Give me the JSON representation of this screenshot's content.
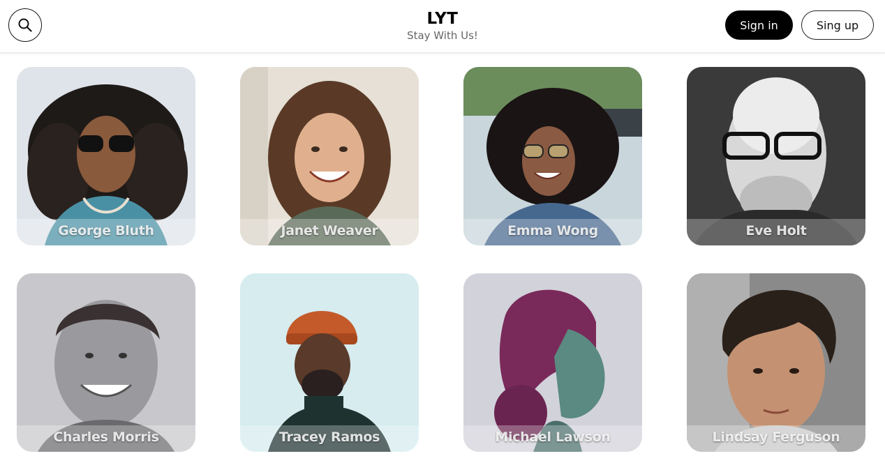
{
  "header": {
    "title": "LYT",
    "subtitle": "Stay With Us!",
    "search_icon": "search-icon",
    "signin_label": "Sign in",
    "signup_label": "Sing up"
  },
  "colors": {
    "primary_button_bg": "#000000",
    "primary_button_text": "#ffffff",
    "subtitle_text": "#666666"
  },
  "users": [
    {
      "name": "George Bluth"
    },
    {
      "name": "Janet Weaver"
    },
    {
      "name": "Emma Wong"
    },
    {
      "name": "Eve Holt"
    },
    {
      "name": "Charles Morris"
    },
    {
      "name": "Tracey Ramos"
    },
    {
      "name": "Michael Lawson"
    },
    {
      "name": "Lindsay Ferguson"
    }
  ]
}
